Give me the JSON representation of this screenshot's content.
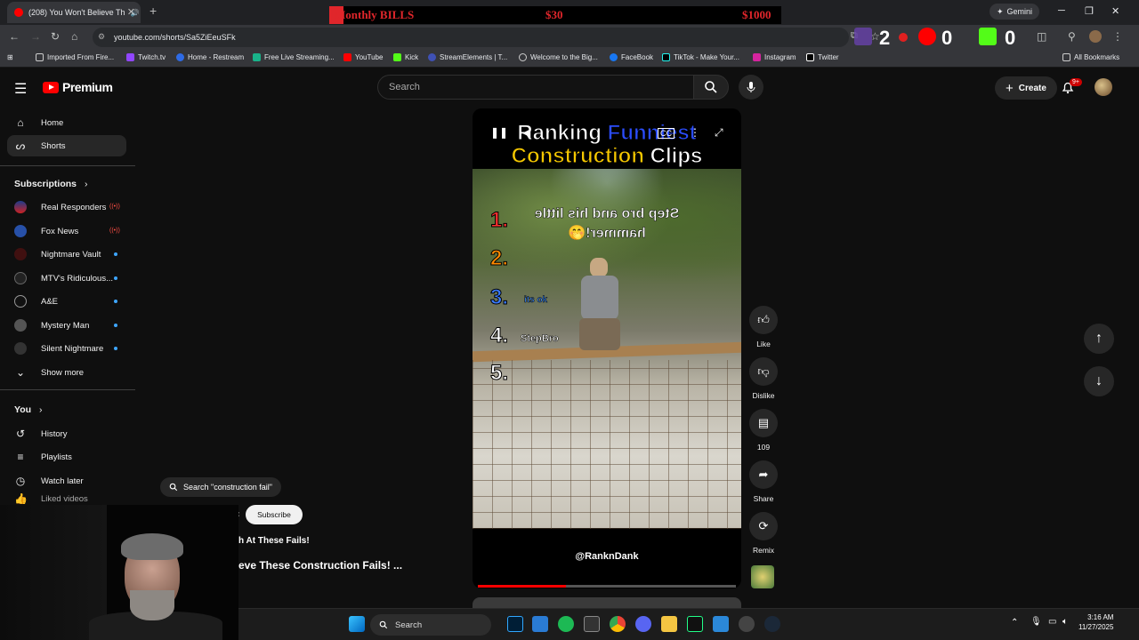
{
  "browser": {
    "tab_title": "(208) You Won't Believe Th",
    "new_tab": "+",
    "close_tab": "✕",
    "overlay": {
      "t1": "Monthly BILLS",
      "t2": "$30",
      "t3": "$1000"
    },
    "gemini": "Gemini",
    "url": "youtube.com/shorts/Sa5ZiEeuSFk",
    "ext_counts": {
      "twitch": "2",
      "youtube": "0",
      "kick": "0"
    },
    "bookmarks": [
      "Imported From Fire...",
      "Twitch.tv",
      "Home - Restream",
      "Free Live Streaming...",
      "YouTube",
      "Kick",
      "StreamElements | T...",
      "Welcome to the Big...",
      "FaceBook",
      "TikTok - Make Your...",
      "Instagram",
      "Twitter"
    ],
    "all_bookmarks": "All Bookmarks"
  },
  "header": {
    "brand": "Premium",
    "search_placeholder": "Search",
    "create": "Create",
    "notif_badge": "9+"
  },
  "sidebar": {
    "main": [
      {
        "label": "Home",
        "icon": "home-icon"
      },
      {
        "label": "Shorts",
        "icon": "shorts-icon"
      }
    ],
    "subs_title": "Subscriptions",
    "subs": [
      "Real Responders",
      "Fox News",
      "Nightmare Vault",
      "MTV's Ridiculous...",
      "A&E",
      "Mystery Man",
      "Silent Nightmare"
    ],
    "show_more": "Show more",
    "you_title": "You",
    "you": [
      "History",
      "Playlists",
      "Watch later",
      "Liked videos"
    ]
  },
  "short": {
    "title_line1_a": "Ranking ",
    "title_line1_b": "Funniest",
    "title_line2_a": "Construction ",
    "title_line2_b": "Clips",
    "ranks": [
      "1.",
      "2.",
      "3.",
      "4.",
      "5."
    ],
    "caption_flipped": "Step bro and his little hammer!🤭",
    "its_ok": "its ok",
    "stepbro": "StepBro",
    "handle": "@RanknDank",
    "progress": 0.34
  },
  "actions": {
    "like": "Like",
    "dislike": "Dislike",
    "comments": "109",
    "share": "Share",
    "remix": "Remix"
  },
  "below": {
    "suggestion": "Search \"construction fail\"",
    "subscribe": "Subscribe",
    "line1": "h At These Fails!",
    "line2": "eve These Construction Fails! ..."
  },
  "taskbar": {
    "search": "Search",
    "time": "3:16 AM",
    "date": "11/27/2025"
  },
  "colors": {
    "yt_red": "#ff0000",
    "accent_blue": "#3ea6ff"
  }
}
